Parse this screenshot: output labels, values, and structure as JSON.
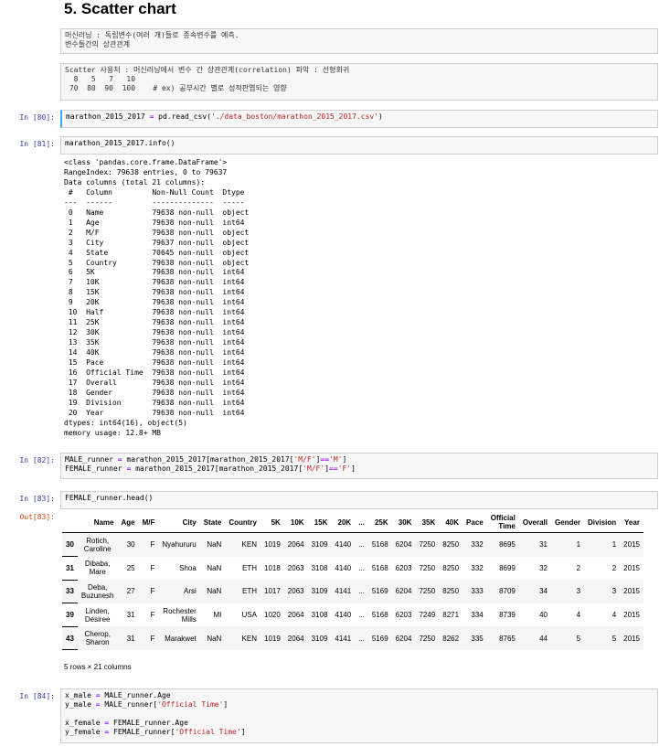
{
  "heading": "5. Scatter chart",
  "md1": {
    "line1": "머신러닝 : 독립변수(여러 개)들로 종속변수를 예측.",
    "line2": "변수들간의 상관관계"
  },
  "md2": {
    "line1": "Scatter 사용처 : 머신러닝에서 변수 간 상관관계(correlation) 파악 : 선형회귀",
    "line2": "  8   5   7   10",
    "line3": " 70  80  90  100    # ex) 공부시간 별로 성적판엽되는 영향"
  },
  "cells": {
    "c80": {
      "prompt": "In [80]:",
      "code_a": "marathon_2015_2017 ",
      "eq": "=",
      "code_b": " pd.read_csv(",
      "str": "'./data_boston/marathon_2015_2017.csv'",
      "code_c": ")"
    },
    "c81": {
      "prompt": "In [81]:",
      "code": "marathon_2015_2017.info()"
    },
    "c82": {
      "prompt": "In [82]:",
      "l1a": "MALE_runner ",
      "l1eq": "=",
      "l1b": " marathon_2015_2017[marathon_2015_2017[",
      "l1s": "'M/F'",
      "l1c": "]",
      "l1op": "==",
      "l1s2": "'M'",
      "l1d": "]",
      "l2a": "FEMALE_runner ",
      "l2eq": "=",
      "l2b": " marathon_2015_2017[marathon_2015_2017[",
      "l2s": "'M/F'",
      "l2c": "]",
      "l2op": "==",
      "l2s2": "'F'",
      "l2d": "]"
    },
    "c83": {
      "prompt": "In [83]:",
      "code": "FEMALE_runner.head()",
      "out_prompt": "Out[83]:"
    },
    "c84": {
      "prompt": "In [84]:",
      "l1a": "x_male ",
      "l1eq": "=",
      "l1b": " MALE_runner.Age",
      "l2a": "y_male ",
      "l2eq": "=",
      "l2b": " MALE_runner[",
      "l2s": "'Official Time'",
      "l2c": "]",
      "l3a": "x_female ",
      "l3eq": "=",
      "l3b": " FEMALE_runner.Age",
      "l4a": "y_female ",
      "l4eq": "=",
      "l4b": " FEMALE_runner[",
      "l4s": "'Official Time'",
      "l4c": "]"
    }
  },
  "info_output": "<class 'pandas.core.frame.DataFrame'>\nRangeIndex: 79638 entries, 0 to 79637\nData columns (total 21 columns):\n #   Column         Non-Null Count  Dtype \n---  ------         --------------  ----- \n 0   Name           79638 non-null  object\n 1   Age            79638 non-null  int64 \n 2   M/F            79638 non-null  object\n 3   City           79637 non-null  object\n 4   State          70645 non-null  object\n 5   Country        79638 non-null  object\n 6   5K             79638 non-null  int64 \n 7   10K            79638 non-null  int64 \n 8   15K            79638 non-null  int64 \n 9   20K            79638 non-null  int64 \n 10  Half           79638 non-null  int64 \n 11  25K            79638 non-null  int64 \n 12  30K            79638 non-null  int64 \n 13  35K            79638 non-null  int64 \n 14  40K            79638 non-null  int64 \n 15  Pace           79638 non-null  int64 \n 16  Official Time  79638 non-null  int64 \n 17  Overall        79638 non-null  int64 \n 18  Gender         79638 non-null  int64 \n 19  Division       79638 non-null  int64 \n 20  Year           79638 non-null  int64 \ndtypes: int64(16), object(5)\nmemory usage: 12.8+ MB",
  "table": {
    "columns": [
      "",
      "Name",
      "Age",
      "M/F",
      "City",
      "State",
      "Country",
      "5K",
      "10K",
      "15K",
      "20K",
      "...",
      "25K",
      "30K",
      "35K",
      "40K",
      "Pace",
      "Official\nTime",
      "Overall",
      "Gender",
      "Division",
      "Year"
    ],
    "rows": [
      [
        "30",
        "Rotich,\nCaroline",
        "30",
        "F",
        "Nyahururu",
        "NaN",
        "KEN",
        "1019",
        "2064",
        "3109",
        "4140",
        "...",
        "5168",
        "6204",
        "7250",
        "8250",
        "332",
        "8695",
        "31",
        "1",
        "1",
        "2015"
      ],
      [
        "31",
        "Dibaba,\nMare",
        "25",
        "F",
        "Shoa",
        "NaN",
        "ETH",
        "1018",
        "2063",
        "3108",
        "4140",
        "...",
        "5168",
        "6203",
        "7250",
        "8250",
        "332",
        "8699",
        "32",
        "2",
        "2",
        "2015"
      ],
      [
        "33",
        "Deba,\nBuzunesh",
        "27",
        "F",
        "Arsi",
        "NaN",
        "ETH",
        "1017",
        "2063",
        "3109",
        "4141",
        "...",
        "5169",
        "6204",
        "7250",
        "8250",
        "333",
        "8709",
        "34",
        "3",
        "3",
        "2015"
      ],
      [
        "39",
        "Linden,\nDesiree",
        "31",
        "F",
        "Rochester\nMills",
        "MI",
        "USA",
        "1020",
        "2064",
        "3108",
        "4140",
        "...",
        "5168",
        "6203",
        "7249",
        "8271",
        "334",
        "8739",
        "40",
        "4",
        "4",
        "2015"
      ],
      [
        "43",
        "Cherop,\nSharon",
        "31",
        "F",
        "Marakwet",
        "NaN",
        "KEN",
        "1019",
        "2064",
        "3109",
        "4141",
        "...",
        "5169",
        "6204",
        "7250",
        "8262",
        "335",
        "8765",
        "44",
        "5",
        "5",
        "2015"
      ]
    ],
    "footer": "5 rows × 21 columns"
  }
}
